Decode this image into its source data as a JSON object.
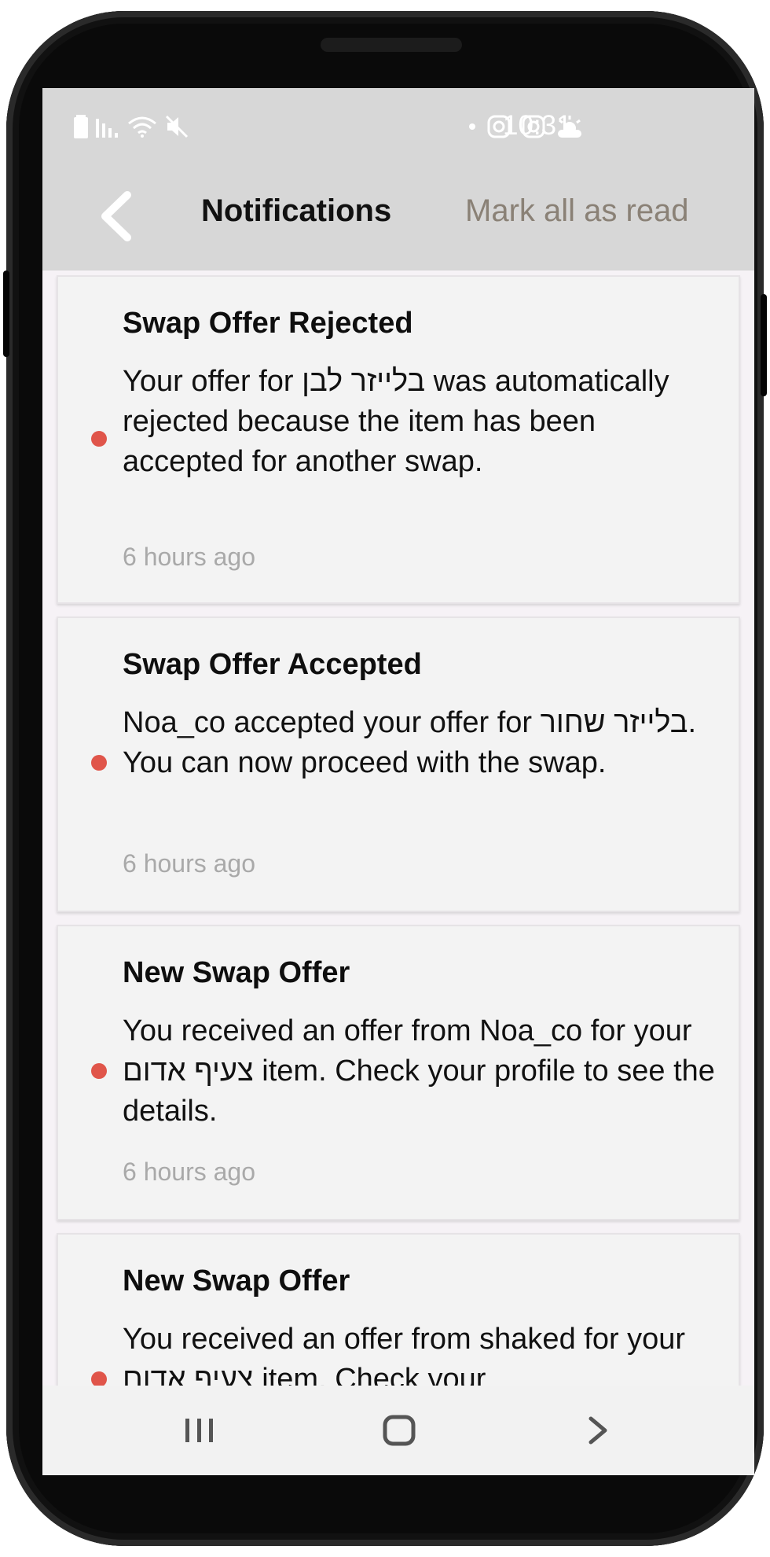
{
  "status": {
    "time": "10:31",
    "left_icons": [
      "battery-icon",
      "signal-icon",
      "wifi-icon",
      "mute-icon"
    ],
    "right_icons": [
      "dot-icon",
      "instagram-icon",
      "instagram-icon",
      "weather-icon"
    ]
  },
  "header": {
    "title": "Notifications",
    "mark_all": "Mark all as read"
  },
  "notifications": [
    {
      "title": "Swap Offer Rejected",
      "body": "Your offer for בלייזר לבן was automatically rejected because the item has been accepted for another swap.",
      "time": "6 hours ago",
      "unread": true
    },
    {
      "title": "Swap Offer Accepted",
      "body": "Noa_co accepted your offer for בלייזר שחור. You can now proceed with the swap.",
      "time": "6 hours ago",
      "unread": true
    },
    {
      "title": "New Swap Offer",
      "body": "You received an offer from Noa_co for your צעיף אדום item. Check your profile to see the details.",
      "time": "6 hours ago",
      "unread": true
    },
    {
      "title": "New Swap Offer",
      "body": "You received an offer from shaked for your צעיף אדום item. Check your",
      "unread": true
    }
  ],
  "colors": {
    "unread_dot": "#e0554a",
    "header_bg": "#d7d7d7",
    "mark_all": "#8a8176"
  }
}
